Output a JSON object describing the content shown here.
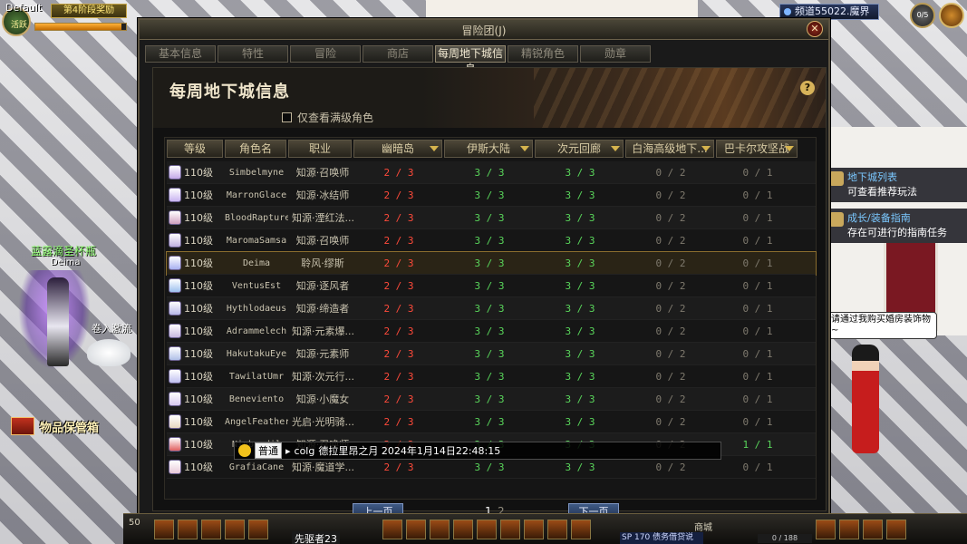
{
  "hud": {
    "player_name": "Default",
    "player_mini": "活跃",
    "stage_banner": "第4阶段奖励",
    "hp_percent": 95,
    "channel": "频道55022.魔界",
    "orb_label": "0/5"
  },
  "scene": {
    "npc_title": "蓝露滴圣杯瓶",
    "npc_sub": "Deima",
    "pet_label": "卷入激流",
    "storage_label": "物品保管箱",
    "guide1_title": "地下城列表",
    "guide1_desc": "可查看推荐玩法",
    "guide2_title": "成长/装备指南",
    "guide2_desc": "存在可进行的指南任务",
    "speech": "请通过我购买婚房装饰物~"
  },
  "dialog": {
    "title": "冒险团(J)",
    "close_glyph": "✕",
    "tabs": [
      {
        "label": "基本信息"
      },
      {
        "label": "特性"
      },
      {
        "label": "冒险"
      },
      {
        "label": "商店"
      },
      {
        "label": "每周地下城信息"
      },
      {
        "label": "精锐角色"
      },
      {
        "label": "勋章"
      }
    ],
    "active_tab": 4,
    "heading": "每周地下城信息",
    "help_glyph": "?",
    "maxlvl_label": "仅查看满级角色",
    "columns": [
      {
        "label": "等级",
        "arrow": false
      },
      {
        "label": "角色名",
        "arrow": false
      },
      {
        "label": "职业",
        "arrow": false
      },
      {
        "label": "幽暗岛",
        "arrow": true
      },
      {
        "label": "伊斯大陆",
        "arrow": true
      },
      {
        "label": "次元回廊",
        "arrow": true
      },
      {
        "label": "白海高级地下...",
        "arrow": true
      },
      {
        "label": "巴卡尔攻坚战",
        "arrow": true
      }
    ],
    "rows": [
      {
        "level": "110级",
        "name": "Simbelmyne",
        "job": "知源·召唤师",
        "d": [
          "2 / 3",
          "3 / 3",
          "3 / 3",
          "0 / 2",
          "0 / 1"
        ],
        "color": "#c4a8e8"
      },
      {
        "level": "110级",
        "name": "MarronGlace",
        "job": "知源·冰结师",
        "d": [
          "2 / 3",
          "3 / 3",
          "3 / 3",
          "0 / 2",
          "0 / 1"
        ],
        "color": "#c8b4f0"
      },
      {
        "level": "110级",
        "name": "BloodRapture",
        "job": "知源·湮红法...",
        "d": [
          "2 / 3",
          "3 / 3",
          "3 / 3",
          "0 / 2",
          "0 / 1"
        ],
        "color": "#d0a0c0"
      },
      {
        "level": "110级",
        "name": "MaromaSamsa",
        "job": "知源·召唤师",
        "d": [
          "2 / 3",
          "3 / 3",
          "3 / 3",
          "0 / 2",
          "0 / 1"
        ],
        "color": "#c0b0e0"
      },
      {
        "level": "110级",
        "name": "Deima",
        "job": "聆风·缪斯",
        "d": [
          "2 / 3",
          "3 / 3",
          "3 / 3",
          "0 / 2",
          "0 / 1"
        ],
        "color": "#a8b0f0"
      },
      {
        "level": "110级",
        "name": "VentusEst",
        "job": "知源·逐风者",
        "d": [
          "2 / 3",
          "3 / 3",
          "3 / 3",
          "0 / 2",
          "0 / 1"
        ],
        "color": "#9cc0ee"
      },
      {
        "level": "110级",
        "name": "Hythlodaeus",
        "job": "知源·缔造者",
        "d": [
          "2 / 3",
          "3 / 3",
          "3 / 3",
          "0 / 2",
          "0 / 1"
        ],
        "color": "#b8b8e8"
      },
      {
        "level": "110级",
        "name": "Adrammelech",
        "job": "知源·元素爆...",
        "d": [
          "2 / 3",
          "3 / 3",
          "3 / 3",
          "0 / 2",
          "0 / 1"
        ],
        "color": "#c8b8e0"
      },
      {
        "level": "110级",
        "name": "HakutakuEye",
        "job": "知源·元素师",
        "d": [
          "2 / 3",
          "3 / 3",
          "3 / 3",
          "0 / 2",
          "0 / 1"
        ],
        "color": "#b0c0e8"
      },
      {
        "level": "110级",
        "name": "TawilatUmr",
        "job": "知源·次元行...",
        "d": [
          "2 / 3",
          "3 / 3",
          "3 / 3",
          "0 / 2",
          "0 / 1"
        ],
        "color": "#c0c0f0"
      },
      {
        "level": "110级",
        "name": "Beneviento",
        "job": "知源·小魔女",
        "d": [
          "2 / 3",
          "3 / 3",
          "3 / 3",
          "0 / 2",
          "0 / 1"
        ],
        "color": "#d8c8f0"
      },
      {
        "level": "110级",
        "name": "AngelFeather",
        "job": "光启·光明骑...",
        "d": [
          "2 / 3",
          "3 / 3",
          "3 / 3",
          "0 / 2",
          "0 / 1"
        ],
        "color": "#e8d8c0"
      },
      {
        "level": "110级",
        "name": "Ninbredil",
        "job": "知源·召唤师",
        "d": [
          "2 / 3",
          "3 / 3",
          "3 / 3",
          "0 / 2",
          "1 / 1"
        ],
        "color": "#e06060"
      },
      {
        "level": "110级",
        "name": "GrafiaCane",
        "job": "知源·魔道学...",
        "d": [
          "2 / 3",
          "3 / 3",
          "3 / 3",
          "0 / 2",
          "0 / 1"
        ],
        "color": "#e8c8d8"
      }
    ],
    "selected_row": 4,
    "pager": {
      "prev": "上一页",
      "next": "下一页",
      "page1": "1",
      "page2": "2"
    }
  },
  "chat": {
    "channel": "普通",
    "sender": "colg",
    "message": "德拉里昂之月 2024年1月14日22:48:15"
  },
  "bottom": {
    "level_text": "50",
    "name_tag": "先驱者23",
    "sp_label": "SP",
    "sp_value": "170",
    "sp_desc": "债务借贷说",
    "exp_text": "0 / 188",
    "menu_label": "商城"
  }
}
